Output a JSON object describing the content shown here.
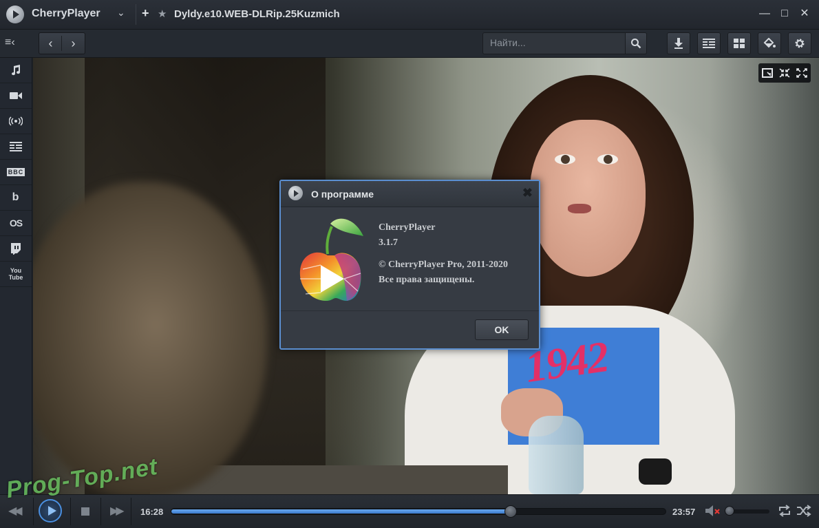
{
  "app": {
    "title": "CherryPlayer",
    "file_title": "Dyldy.e10.WEB-DLRip.25Kuzmich",
    "accent": "#4a8fe0"
  },
  "toolbar": {
    "search_placeholder": "Найти..."
  },
  "sidebar": {
    "items": [
      {
        "icon": "music-note-icon",
        "text": ""
      },
      {
        "icon": "video-camera-icon",
        "text": ""
      },
      {
        "icon": "radio-broadcast-icon",
        "text": ""
      },
      {
        "icon": "tv-guide-icon",
        "text": ""
      },
      {
        "icon": "bbc-icon",
        "text": "BBC"
      },
      {
        "icon": "beatport-icon",
        "text": "b"
      },
      {
        "icon": "lastfm-icon",
        "text": "OS"
      },
      {
        "icon": "twitch-icon",
        "text": ""
      },
      {
        "icon": "youtube-icon",
        "text": "You Tube"
      }
    ]
  },
  "video": {
    "print_text": "1942",
    "watermark": "Prog-Top.net"
  },
  "dialog": {
    "title": "О программе",
    "product": "CherryPlayer",
    "version": "3.1.7",
    "copyright": "© CherryPlayer Pro, 2011-2020",
    "rights": "Все права защищены.",
    "ok_label": "OK"
  },
  "player": {
    "elapsed": "16:28",
    "total": "23:57",
    "progress_fraction": 0.686,
    "volume_fraction": 0.1,
    "muted": true
  }
}
